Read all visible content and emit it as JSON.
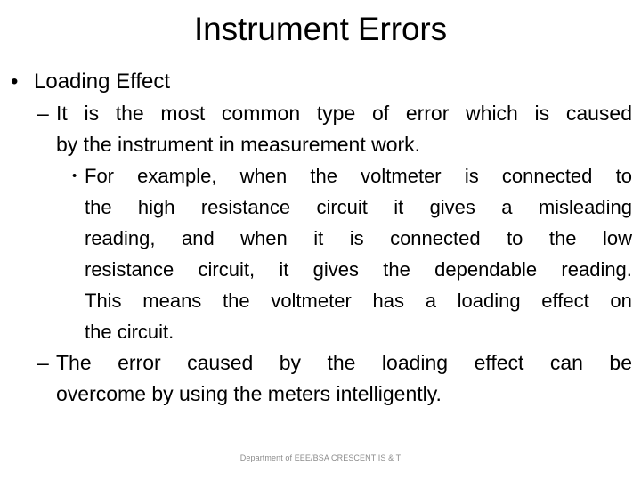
{
  "slide": {
    "title": "Instrument Errors",
    "footer": "Department of EEE/BSA CRESCENT IS & T",
    "background_color": "#ffffff",
    "text_color": "#000000",
    "footer_color": "#8c8c8c"
  },
  "outline": {
    "level1": {
      "marker": "•",
      "text": "Loading Effect"
    },
    "level2_first": {
      "marker": "–",
      "text": "It is the most common type of error which is caused by the instrument in measurement work.",
      "lines": [
        [
          "It",
          "is",
          "the",
          "most",
          "common",
          "type",
          "of",
          "error",
          "which",
          "is",
          "caused"
        ],
        [
          "by the instrument in measurement work."
        ]
      ]
    },
    "level3": {
      "marker": "•",
      "text": "For example, when the voltmeter is connected to the high resistance circuit it gives a misleading reading, and when it is connected to the low resistance circuit, it gives the dependable reading. This means the voltmeter has a loading effect on the circuit.",
      "lines": [
        [
          "For",
          "example,",
          "when",
          "the",
          "voltmeter",
          "is",
          "connected",
          "to"
        ],
        [
          "the",
          "high",
          "resistance",
          "circuit",
          "it",
          "gives",
          "a",
          "misleading"
        ],
        [
          "reading,",
          "and",
          "when",
          "it",
          "is",
          "connected",
          "to",
          "the",
          "low"
        ],
        [
          "resistance",
          "circuit,",
          "it",
          "gives",
          "the",
          "dependable",
          "reading."
        ],
        [
          "This",
          "means",
          "the",
          "voltmeter",
          "has",
          "a",
          "loading",
          "effect",
          "on"
        ],
        [
          "the circuit."
        ]
      ]
    },
    "level2_second": {
      "marker": "–",
      "text": "The error caused by the loading effect can be overcome by using the meters intelligently.",
      "lines": [
        [
          "The",
          "error",
          "caused",
          "by",
          "the",
          "loading",
          "effect",
          "can",
          "be"
        ],
        [
          "overcome by using the meters intelligently."
        ]
      ]
    }
  }
}
